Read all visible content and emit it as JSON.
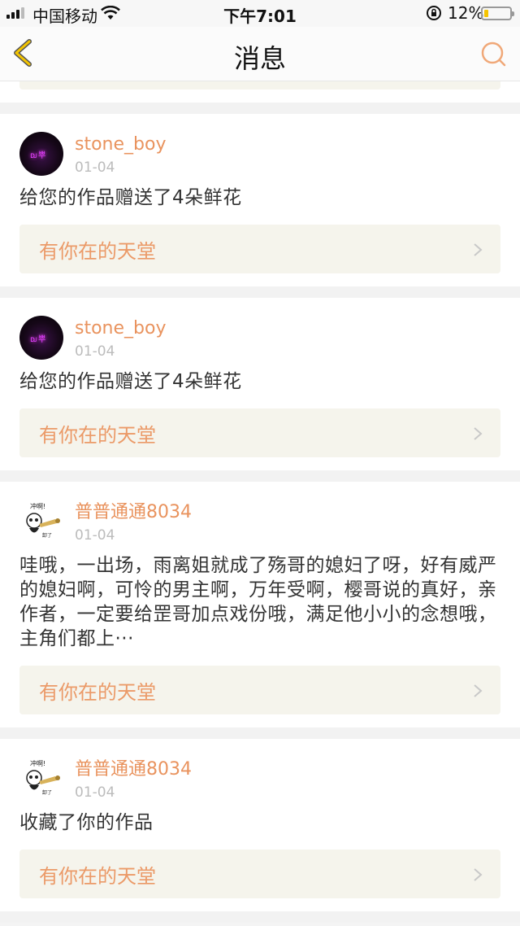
{
  "status_bar": {
    "carrier": "中国移动",
    "time": "下午7:01",
    "battery_percent": "12%",
    "battery_level": 0.12,
    "icons": [
      "signal-icon",
      "wifi-icon",
      "orientation-lock-icon",
      "battery-icon"
    ]
  },
  "nav": {
    "title": "消息",
    "back_icon": "chevron-left-icon",
    "search_icon": "search-icon"
  },
  "colors": {
    "accent": "#e9935e",
    "work_bg": "#f5f4ec",
    "date": "#bcbcbc"
  },
  "messages": [
    {
      "user": "stone_boy",
      "date": "01-04",
      "text": "给您的作品赠送了4朵鲜花",
      "work": "有你在的天堂",
      "avatar": "dark"
    },
    {
      "user": "stone_boy",
      "date": "01-04",
      "text": "给您的作品赠送了4朵鲜花",
      "work": "有你在的天堂",
      "avatar": "dark"
    },
    {
      "user": "普普通通8034",
      "date": "01-04",
      "text": "哇哦，一出场，雨离姐就成了殇哥的媳妇了呀，好有威严的媳妇啊，可怜的男主啊，万年受啊，樱哥说的真好，亲作者，一定要给罡哥加点戏份哦，满足他小小的念想哦，主角们都上···",
      "work": "有你在的天堂",
      "avatar": "panda"
    },
    {
      "user": "普普通通8034",
      "date": "01-04",
      "text": "收藏了你的作品",
      "work": "有你在的天堂",
      "avatar": "panda"
    }
  ]
}
